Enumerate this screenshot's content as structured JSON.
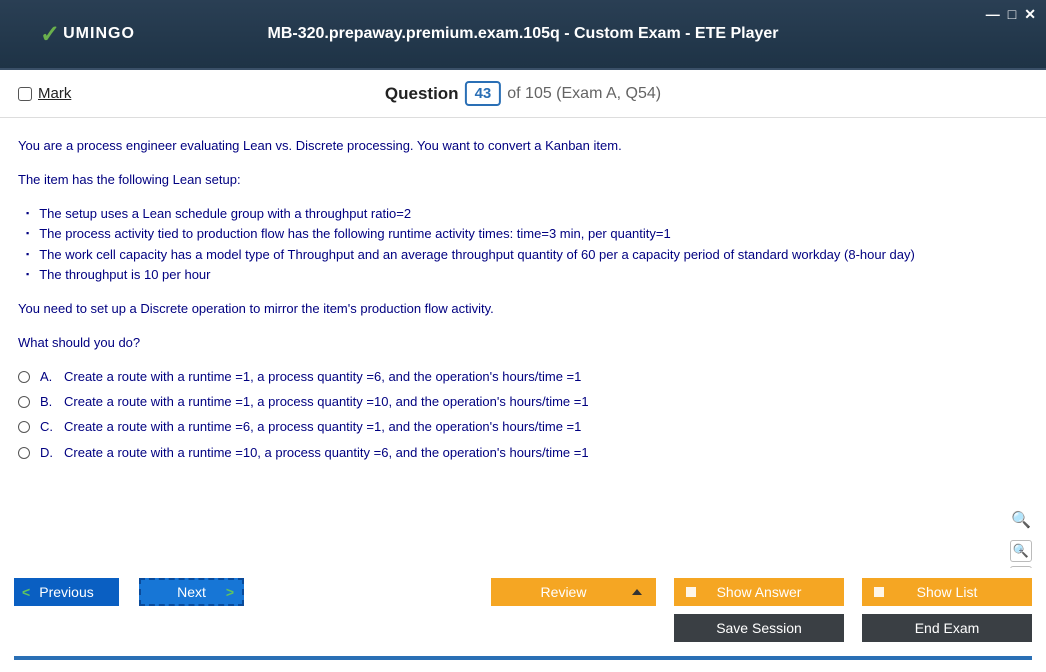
{
  "window": {
    "title": "MB-320.prepaway.premium.exam.105q - Custom Exam - ETE Player",
    "logo_text": "UMINGO"
  },
  "header": {
    "mark_label": "Mark",
    "question_word": "Question",
    "question_number": "43",
    "of_text": "of 105 (Exam A, Q54)"
  },
  "body": {
    "intro1": "You are a process engineer evaluating Lean vs. Discrete processing. You want to convert a Kanban item.",
    "intro2": "The item has the following Lean setup:",
    "bullets": [
      "The setup uses a Lean schedule group with a throughput ratio=2",
      "The process activity tied to production flow has the following runtime activity times: time=3 min, per quantity=1",
      "The work cell capacity has a model type of Throughput and an average throughput quantity of 60 per a capacity period of standard workday (8-hour day)",
      "The throughput is 10 per hour"
    ],
    "need": "You need to set up a Discrete operation to mirror the item's production flow activity.",
    "prompt": "What should you do?",
    "options": [
      {
        "letter": "A.",
        "text": "Create a route with a runtime =1, a process quantity =6, and the operation's hours/time =1"
      },
      {
        "letter": "B.",
        "text": "Create a route with a runtime =1, a process quantity =10, and the operation's hours/time =1"
      },
      {
        "letter": "C.",
        "text": "Create a route with a runtime =6, a process quantity =1, and the operation's hours/time =1"
      },
      {
        "letter": "D.",
        "text": "Create a route with a runtime =10, a process quantity =6, and the operation's hours/time =1"
      }
    ]
  },
  "buttons": {
    "previous": "Previous",
    "next": "Next",
    "review": "Review",
    "show_answer": "Show Answer",
    "show_list": "Show List",
    "save_session": "Save Session",
    "end_exam": "End Exam"
  }
}
